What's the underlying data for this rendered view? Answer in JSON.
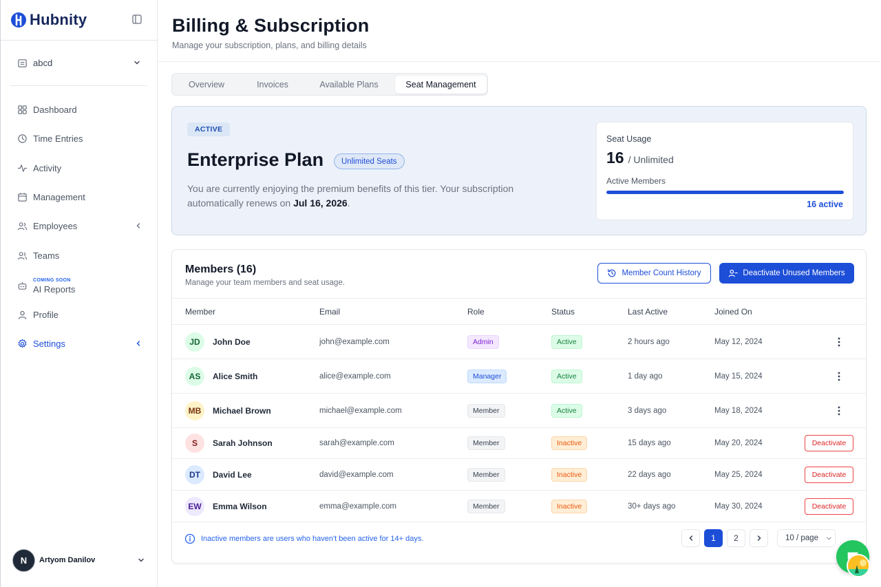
{
  "brand": {
    "name": "Hubnity",
    "logo_color": "#1d4ed8"
  },
  "workspace": {
    "name": "abcd"
  },
  "nav": [
    {
      "label": "Dashboard",
      "icon": "dashboard-icon",
      "top": 0
    },
    {
      "label": "Time Entries",
      "icon": "clock-icon"
    },
    {
      "label": "Activity",
      "icon": "activity-icon"
    },
    {
      "label": "Management",
      "icon": "calendar-icon"
    },
    {
      "label": "Employees",
      "icon": "users-icon"
    },
    {
      "label": "Teams",
      "icon": "users-icon"
    },
    {
      "label": "AI Reports",
      "badge": "COMING SOON",
      "icon": "robot-icon"
    },
    {
      "label": "Profile",
      "icon": "user-icon"
    },
    {
      "label": "Settings",
      "icon": "gear-icon"
    }
  ],
  "user": {
    "initial": "N",
    "name": "Artyom Danilov"
  },
  "page": {
    "title": "Billing & Subscription",
    "subtitle": "Manage your subscription, plans, and billing details"
  },
  "tabs": [
    "Overview",
    "Invoices",
    "Available Plans",
    "Seat Management"
  ],
  "selected_tab": "Seat Management",
  "plan": {
    "status": "ACTIVE",
    "name": "Enterprise Plan",
    "seats_badge": "Unlimited Seats",
    "desc_prefix": "You are currently enjoying the premium benefits of this tier. Your subscription automatically renews on ",
    "renew_date": "Jul 16, 2026",
    "desc_suffix": "."
  },
  "usage": {
    "title": "Seat Usage",
    "count": "16",
    "unit": "/ Unlimited",
    "label": "Active Members",
    "fill_fraction": 1.0,
    "active_text": "16 active"
  },
  "members": {
    "title": "Members (16)",
    "subtitle": "Manage your team members and seat usage.",
    "history_button": "Member Count History",
    "deactivate_unused_button": "Deactivate Unused Members",
    "columns": [
      "Member",
      "Email",
      "Role",
      "Status",
      "Last Active",
      "Joined On"
    ],
    "rows": [
      {
        "initials": "JD",
        "name": "John Doe",
        "email": "john@example.com",
        "role": "Admin",
        "status": "Active",
        "last_active": "2 hours ago",
        "joined": "May 12, 2024",
        "action": "menu"
      },
      {
        "initials": "AS",
        "name": "Alice Smith",
        "email": "alice@example.com",
        "role": "Manager",
        "status": "Active",
        "last_active": "1 day ago",
        "joined": "May 15, 2024",
        "action": "menu"
      },
      {
        "initials": "MB",
        "name": "Michael Brown",
        "email": "michael@example.com",
        "role": "Member",
        "status": "Active",
        "last_active": "3 days ago",
        "joined": "May 18, 2024",
        "action": "menu"
      },
      {
        "initials": "S",
        "name": "Sarah Johnson",
        "email": "sarah@example.com",
        "role": "Member",
        "status": "Inactive",
        "last_active": "15 days ago",
        "joined": "May 20, 2024",
        "action": "Deactivate"
      },
      {
        "initials": "DT",
        "name": "David Lee",
        "email": "david@example.com",
        "role": "Member",
        "status": "Inactive",
        "last_active": "22 days ago",
        "joined": "May 25, 2024",
        "action": "Deactivate"
      },
      {
        "initials": "EW",
        "name": "Emma Wilson",
        "email": "emma@example.com",
        "role": "Member",
        "status": "Inactive",
        "last_active": "30+ days ago",
        "joined": "May 30, 2024",
        "action": "Deactivate"
      }
    ],
    "footer_note": "Inactive members are users who haven't been active for 14+ days.",
    "pages": [
      "1",
      "2"
    ],
    "current_page": "1",
    "page_size": "10 / page"
  },
  "colors": {
    "primary": "#1d4ed8",
    "active_green": "#16a34a",
    "inactive_orange": "#ea580c",
    "danger": "#dc2626"
  }
}
